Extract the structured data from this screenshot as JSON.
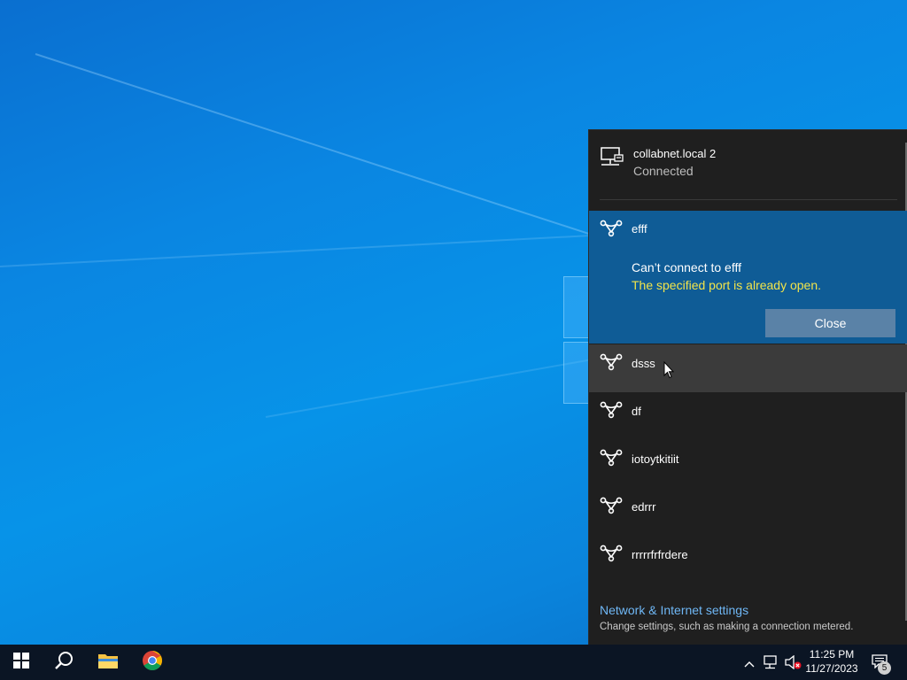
{
  "wired_network": {
    "name": "collabnet.local 2",
    "status": "Connected",
    "icon": "ethernet-icon"
  },
  "expanded_network": {
    "name": "efff",
    "error_title": "Can’t connect to efff",
    "error_detail": "The specified port is already open.",
    "close_label": "Close",
    "icon": "dialup-icon"
  },
  "networks": [
    {
      "name": "dsss",
      "icon": "dialup-icon"
    },
    {
      "name": "df",
      "icon": "dialup-icon"
    },
    {
      "name": "iotoytkitiit",
      "icon": "dialup-icon"
    },
    {
      "name": "edrrr",
      "icon": "dialup-icon"
    },
    {
      "name": "rrrrrfrfrdere",
      "icon": "dialup-icon"
    }
  ],
  "settings": {
    "link_label": "Network & Internet settings",
    "description": "Change settings, such as making a connection metered."
  },
  "taskbar": {
    "time": "11:25 PM",
    "date": "11/27/2023",
    "notification_count": "5",
    "pinned": [
      "start-icon",
      "search-icon",
      "file-explorer-icon",
      "chrome-icon"
    ],
    "tray": [
      "chevron-up-icon",
      "network-icon",
      "volume-muted-icon",
      "action-center-icon"
    ]
  },
  "colors": {
    "flyout_bg": "#1f1f1f",
    "expanded_bg": "#0f5c96",
    "error_text": "#f2e44a",
    "link": "#6fb7f5",
    "taskbar_bg": "#0b1524"
  }
}
